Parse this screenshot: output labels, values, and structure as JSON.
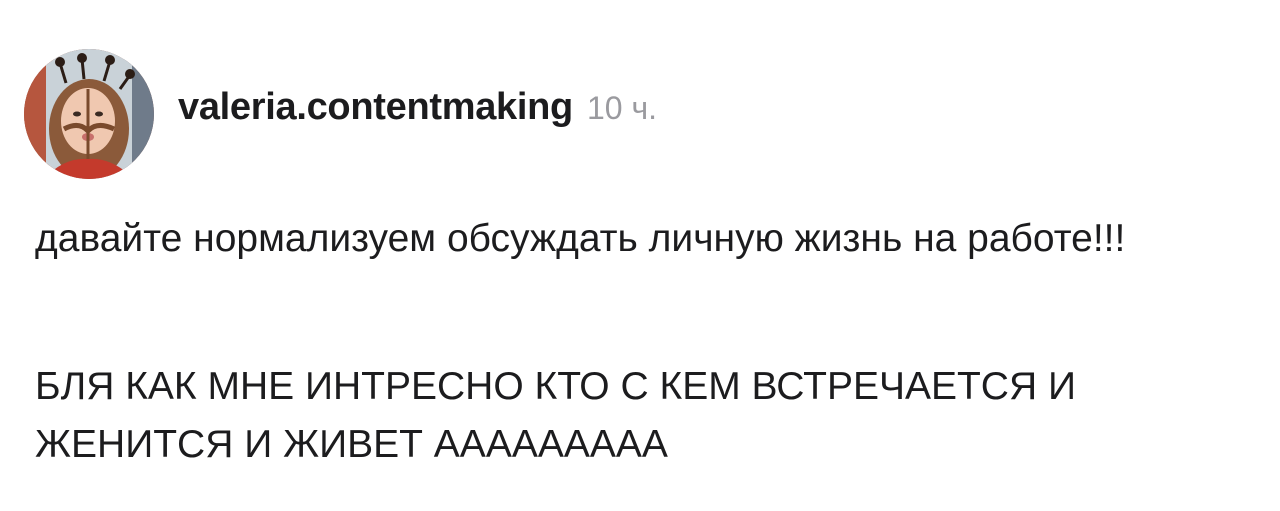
{
  "post": {
    "author": {
      "username": "valeria.contentmaking",
      "avatar_icon": "user-avatar-photo"
    },
    "timestamp": "10 ч.",
    "paragraphs": [
      "давайте нормализуем обсуждать личную жизнь на работе!!!",
      "БЛЯ КАК МНЕ ИНТРЕСНО КТО С КЕМ ВСТРЕЧАЕТСЯ И ЖЕНИТСЯ И ЖИВЕТ ААААААААА"
    ]
  },
  "colors": {
    "text": "#1c1c1e",
    "timestamp": "#9a9a9f",
    "background": "#ffffff"
  }
}
